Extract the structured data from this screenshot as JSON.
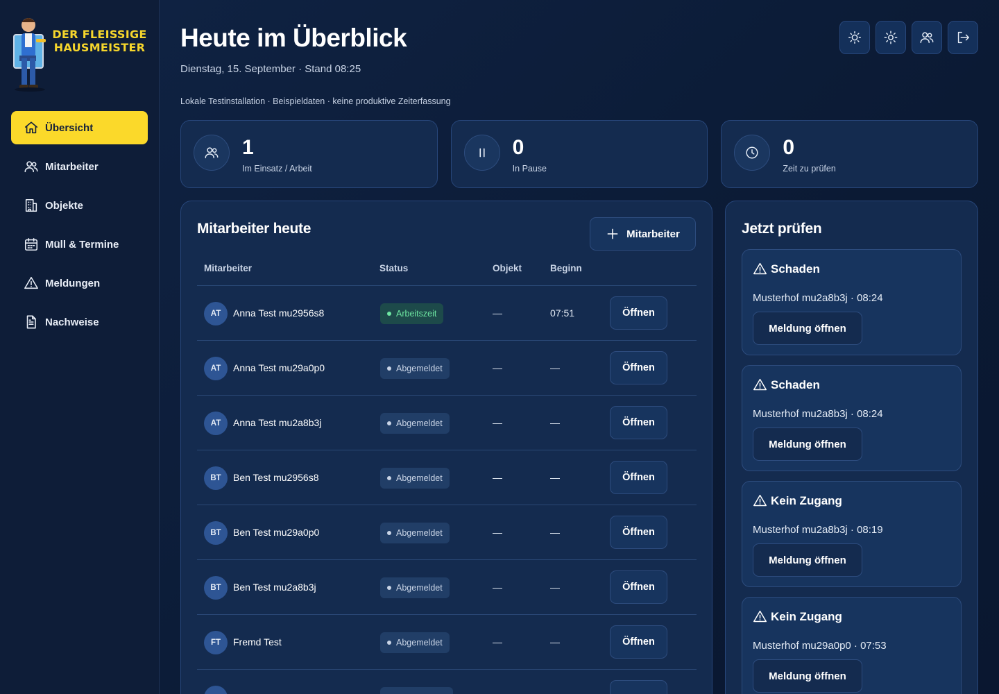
{
  "brand": {
    "line1": "DER FLEISSIGE",
    "line2": "HAUSMEISTER",
    "color": "#f6d62c"
  },
  "sidebar": {
    "items": [
      {
        "label": "Übersicht",
        "icon": "home-icon",
        "active": true
      },
      {
        "label": "Mitarbeiter",
        "icon": "users-icon",
        "active": false
      },
      {
        "label": "Objekte",
        "icon": "building-icon",
        "active": false
      },
      {
        "label": "Müll & Termine",
        "icon": "calendar-icon",
        "active": false
      },
      {
        "label": "Meldungen",
        "icon": "warning-icon",
        "active": false
      },
      {
        "label": "Nachweise",
        "icon": "document-icon",
        "active": false
      }
    ]
  },
  "header": {
    "title": "Heute im Überblick",
    "subtitle": "Dienstag, 15. September · Stand 08:25",
    "note": "Lokale Testinstallation · Beispieldaten · keine produktive Zeiterfassung",
    "buttons": [
      "sun-icon",
      "brightness-icon",
      "users-icon",
      "logout-icon"
    ]
  },
  "stats": [
    {
      "value": "1",
      "label": "Im Einsatz / Arbeit",
      "icon": "users-icon"
    },
    {
      "value": "0",
      "label": "In Pause",
      "icon": "pause-icon"
    },
    {
      "value": "0",
      "label": "Zeit zu prüfen",
      "icon": "clock-icon"
    }
  ],
  "employees": {
    "title": "Mitarbeiter heute",
    "add_label": "Mitarbeiter",
    "columns": {
      "name": "Mitarbeiter",
      "status": "Status",
      "object": "Objekt",
      "begin": "Beginn"
    },
    "rows": [
      {
        "initials": "AT",
        "name": "Anna Test mu2956s8",
        "status": "Arbeitszeit",
        "status_kind": "work",
        "object": "—",
        "begin": "07:51",
        "action": "Öffnen"
      },
      {
        "initials": "AT",
        "name": "Anna Test mu29a0p0",
        "status": "Abgemeldet",
        "status_kind": "off",
        "object": "—",
        "begin": "—",
        "action": "Öffnen"
      },
      {
        "initials": "AT",
        "name": "Anna Test mu2a8b3j",
        "status": "Abgemeldet",
        "status_kind": "off",
        "object": "—",
        "begin": "—",
        "action": "Öffnen"
      },
      {
        "initials": "BT",
        "name": "Ben Test mu2956s8",
        "status": "Abgemeldet",
        "status_kind": "off",
        "object": "—",
        "begin": "—",
        "action": "Öffnen"
      },
      {
        "initials": "BT",
        "name": "Ben Test mu29a0p0",
        "status": "Abgemeldet",
        "status_kind": "off",
        "object": "—",
        "begin": "—",
        "action": "Öffnen"
      },
      {
        "initials": "BT",
        "name": "Ben Test mu2a8b3j",
        "status": "Abgemeldet",
        "status_kind": "off",
        "object": "—",
        "begin": "—",
        "action": "Öffnen"
      },
      {
        "initials": "FT",
        "name": "Fremd Test",
        "status": "Abgemeldet",
        "status_kind": "off",
        "object": "—",
        "begin": "—",
        "action": "Öffnen"
      }
    ]
  },
  "check": {
    "title": "Jetzt prüfen",
    "items": [
      {
        "type": "Schaden",
        "meta": "Musterhof mu2a8b3j · 08:24",
        "action": "Meldung öffnen"
      },
      {
        "type": "Schaden",
        "meta": "Musterhof mu2a8b3j · 08:24",
        "action": "Meldung öffnen"
      },
      {
        "type": "Kein Zugang",
        "meta": "Musterhof mu2a8b3j · 08:19",
        "action": "Meldung öffnen"
      },
      {
        "type": "Kein Zugang",
        "meta": "Musterhof mu29a0p0 · 07:53",
        "action": "Meldung öffnen"
      }
    ]
  }
}
